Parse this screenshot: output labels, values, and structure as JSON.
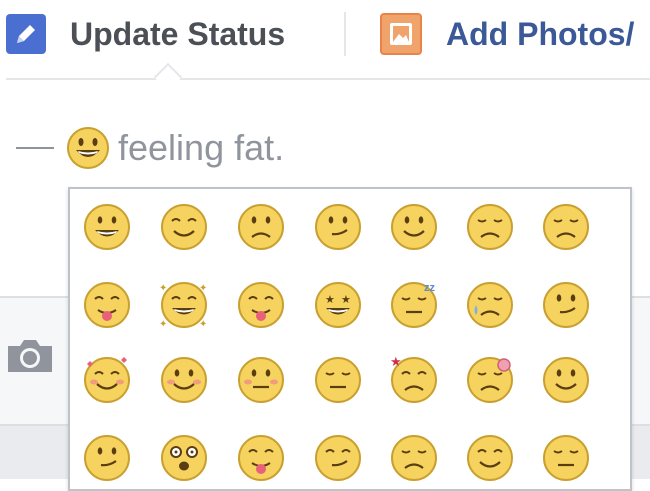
{
  "tabs": {
    "update_status": {
      "label": "Update Status",
      "icon": "pencil-icon"
    },
    "add_photos": {
      "label": "Add Photos/",
      "icon": "photo-icon"
    }
  },
  "composer": {
    "feeling_prefix_icon": "dash",
    "feeling_icon": "grinning-face-icon",
    "feeling_text": "feeling fat."
  },
  "attachments": {
    "camera_icon": "camera-icon"
  },
  "emoji_picker": {
    "colors": {
      "face": "#f6d25f",
      "outline": "#c9a030",
      "border": "#bec3c9"
    },
    "emojis": [
      [
        "grinning",
        "smiling",
        "worried",
        "confused",
        "happy",
        "sad",
        "disappointed"
      ],
      [
        "wink-tongue",
        "star-struck",
        "tongue-out",
        "grin-stars",
        "sleepy",
        "crying",
        "smirk"
      ],
      [
        "in-love",
        "blushing",
        "embarrassed",
        "unamused",
        "angry-injured",
        "sick",
        "pleased"
      ],
      [
        "devilish",
        "shocked",
        "scared",
        "sly",
        "frowning",
        "relieved",
        "grumpy"
      ]
    ]
  }
}
